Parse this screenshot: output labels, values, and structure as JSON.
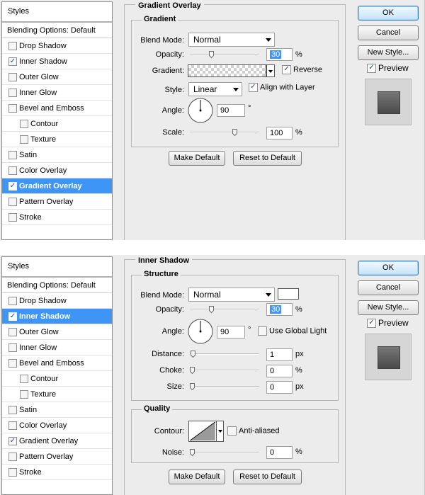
{
  "styles_panel": {
    "title": "Styles",
    "blending_options": "Blending Options: Default",
    "items": [
      {
        "label": "Drop Shadow"
      },
      {
        "label": "Inner Shadow"
      },
      {
        "label": "Outer Glow"
      },
      {
        "label": "Inner Glow"
      },
      {
        "label": "Bevel and Emboss"
      },
      {
        "label": "Contour"
      },
      {
        "label": "Texture"
      },
      {
        "label": "Satin"
      },
      {
        "label": "Color Overlay"
      },
      {
        "label": "Gradient Overlay"
      },
      {
        "label": "Pattern Overlay"
      },
      {
        "label": "Stroke"
      }
    ]
  },
  "dialog1": {
    "section_title": "Gradient Overlay",
    "group_title": "Gradient",
    "blend_mode_label": "Blend Mode:",
    "blend_mode_value": "Normal",
    "opacity_label": "Opacity:",
    "opacity_value": "30",
    "opacity_unit": "%",
    "opacity_slider_percent": 30,
    "gradient_label": "Gradient:",
    "reverse_label": "Reverse",
    "reverse_checked": true,
    "style_label": "Style:",
    "style_value": "Linear",
    "align_label": "Align with Layer",
    "align_checked": true,
    "angle_label": "Angle:",
    "angle_value": "90",
    "angle_unit": "°",
    "scale_label": "Scale:",
    "scale_value": "100",
    "scale_unit": "%",
    "scale_slider_percent": 66,
    "make_default": "Make Default",
    "reset_default": "Reset to Default"
  },
  "dialog2": {
    "section_title": "Inner Shadow",
    "group_title": "Structure",
    "blend_mode_label": "Blend Mode:",
    "blend_mode_value": "Normal",
    "shadow_color": "#ffffff",
    "opacity_label": "Opacity:",
    "opacity_value": "30",
    "opacity_unit": "%",
    "opacity_slider_percent": 30,
    "angle_label": "Angle:",
    "angle_value": "90",
    "angle_unit": "°",
    "global_light_label": "Use Global Light",
    "global_light_checked": false,
    "distance_label": "Distance:",
    "distance_value": "1",
    "distance_unit": "px",
    "distance_slider_percent": 1,
    "choke_label": "Choke:",
    "choke_value": "0",
    "choke_unit": "%",
    "choke_slider_percent": 0,
    "size_label": "Size:",
    "size_value": "0",
    "size_unit": "px",
    "size_slider_percent": 0,
    "quality_title": "Quality",
    "contour_label": "Contour:",
    "anti_aliased_label": "Anti-aliased",
    "anti_aliased_checked": false,
    "noise_label": "Noise:",
    "noise_value": "0",
    "noise_unit": "%",
    "noise_slider_percent": 0,
    "make_default": "Make Default",
    "reset_default": "Reset to Default"
  },
  "buttons": {
    "ok": "OK",
    "cancel": "Cancel",
    "new_style": "New Style...",
    "preview": "Preview",
    "preview_checked": true
  },
  "colors": {
    "selection": "#3f95f5",
    "panel_bg": "#ececec"
  }
}
